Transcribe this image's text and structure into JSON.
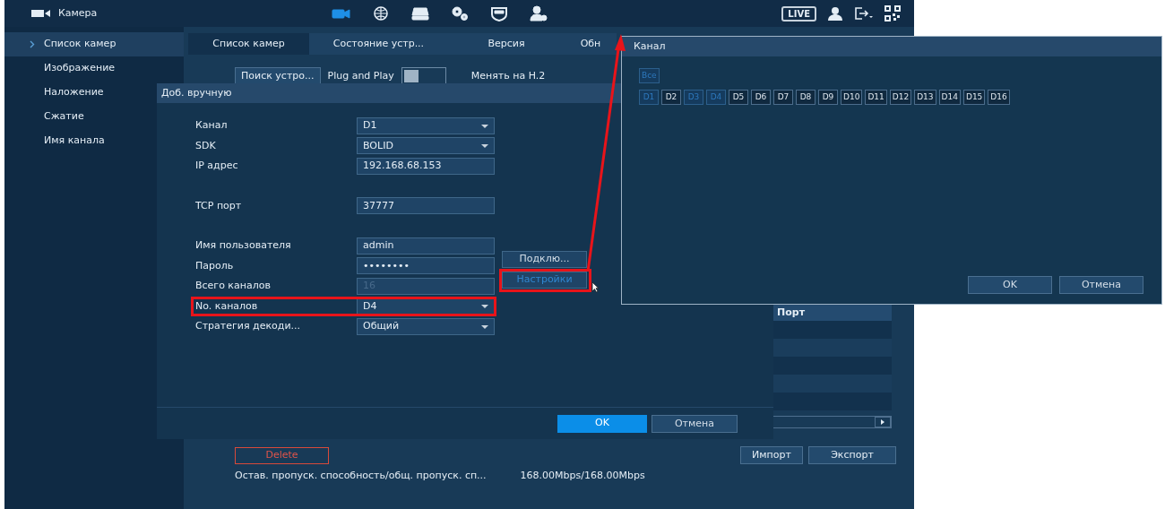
{
  "header": {
    "title": "Камера",
    "nav": [
      {
        "kind": "camera",
        "selected": true
      },
      {
        "kind": "network",
        "selected": false
      },
      {
        "kind": "storage",
        "selected": false
      },
      {
        "kind": "system",
        "selected": false
      },
      {
        "kind": "security",
        "selected": false
      },
      {
        "kind": "account",
        "selected": false
      }
    ],
    "live_badge": "LIVE"
  },
  "sidebar": {
    "items": [
      {
        "label": "Список камер",
        "selected": true
      },
      {
        "label": "Изображение",
        "selected": false
      },
      {
        "label": "Наложение",
        "selected": false
      },
      {
        "label": "Сжатие",
        "selected": false
      },
      {
        "label": "Имя канала",
        "selected": false
      }
    ]
  },
  "tabs": [
    {
      "label": "Список камер",
      "selected": true
    },
    {
      "label": "Состояние устр...",
      "selected": false
    },
    {
      "label": "Версия",
      "selected": false
    },
    {
      "label": "Обн",
      "selected": false
    }
  ],
  "toolbar": {
    "search_button": "Поиск устро...",
    "plug_and_play": {
      "label": "Plug and Play",
      "on": false
    },
    "codec_label": "Менять на H.2"
  },
  "table": {
    "columns": [
      "Порт"
    ]
  },
  "footer": {
    "delete_button": "Delete",
    "import_button": "Импорт",
    "export_button": "Экспорт",
    "bandwidth_label": "Остав. пропуск. способность/общ. пропуск. сп...",
    "bandwidth_value": "168.00Mbps/168.00Mbps"
  },
  "add_dialog": {
    "title": "Доб. вручную",
    "field_groups": [
      [
        {
          "label": "Канал",
          "value": "D1",
          "kind": "select",
          "highlighted": false
        },
        {
          "label": "SDK",
          "value": "BOLID",
          "kind": "select",
          "highlighted": false
        },
        {
          "label": "IP адрес",
          "value": "192.168.68.153",
          "kind": "text",
          "highlighted": false
        }
      ],
      [
        {
          "label": "TCP порт",
          "value": "37777",
          "kind": "text",
          "highlighted": false
        }
      ],
      [
        {
          "label": "Имя пользователя",
          "value": "admin",
          "kind": "text",
          "highlighted": false
        },
        {
          "label": "Пароль",
          "value": "••••••••",
          "kind": "password",
          "highlighted": false
        },
        {
          "label": "Всего каналов",
          "value": "16",
          "kind": "disabled",
          "highlighted": false
        },
        {
          "label": "No. каналов",
          "value": "D4",
          "kind": "select",
          "highlighted": true
        },
        {
          "label": "Стратегия декоди...",
          "value": "Общий",
          "kind": "select",
          "highlighted": false
        }
      ]
    ],
    "side_buttons": [
      {
        "label": "Подклю...",
        "focused": false,
        "highlighted": false
      },
      {
        "label": "Настройки",
        "focused": true,
        "highlighted": true
      }
    ],
    "ok_button": "OK",
    "cancel_button": "Отмена"
  },
  "channel_dialog": {
    "title": "Канал",
    "all": {
      "label": "Все",
      "selected": true
    },
    "channels": [
      {
        "label": "D1",
        "selected": true
      },
      {
        "label": "D2",
        "selected": false
      },
      {
        "label": "D3",
        "selected": true
      },
      {
        "label": "D4",
        "selected": true
      },
      {
        "label": "D5",
        "selected": false
      },
      {
        "label": "D6",
        "selected": false
      },
      {
        "label": "D7",
        "selected": false
      },
      {
        "label": "D8",
        "selected": false
      },
      {
        "label": "D9",
        "selected": false
      },
      {
        "label": "D10",
        "selected": false
      },
      {
        "label": "D11",
        "selected": false
      },
      {
        "label": "D12",
        "selected": false
      },
      {
        "label": "D13",
        "selected": false
      },
      {
        "label": "D14",
        "selected": false
      },
      {
        "label": "D15",
        "selected": false
      },
      {
        "label": "D16",
        "selected": false
      }
    ],
    "ok_button": "OK",
    "cancel_button": "Отмена"
  },
  "annotation": {
    "arrow": true
  }
}
